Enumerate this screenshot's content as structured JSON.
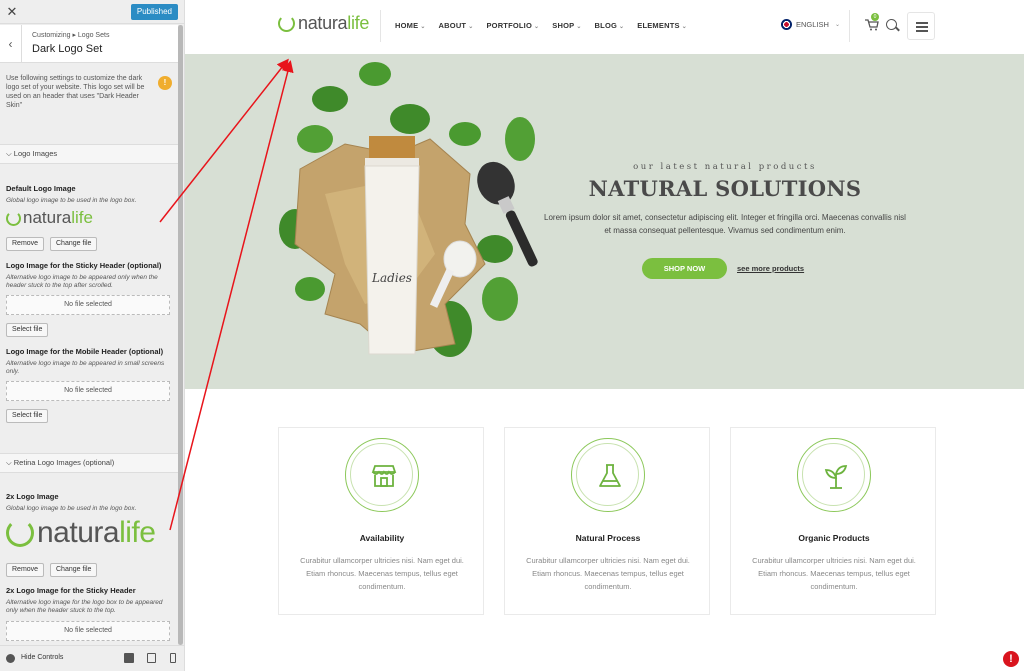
{
  "customizer": {
    "close": "✕",
    "publish_label": "Published",
    "back": "‹",
    "breadcrumb": "Customizing ▸ Logo Sets",
    "panel_title": "Dark Logo Set",
    "description": "Use following settings to customize the dark logo set of your website. This logo set will be used on an header that uses \"Dark Header Skin\"",
    "info_badge": "!",
    "section_logo_images": "⌵ Logo Images",
    "default_logo": {
      "label": "Default Logo Image",
      "help": "Global logo image to be used in the logo box.",
      "remove": "Remove",
      "change": "Change file"
    },
    "sticky_logo": {
      "label": "Logo Image for the Sticky Header (optional)",
      "help": "Alternative logo image to be appeared only when the header stuck to the top after scrolled.",
      "no_file": "No file selected",
      "select": "Select file"
    },
    "mobile_logo": {
      "label": "Logo Image for the Mobile Header (optional)",
      "help": "Alternative logo image to be appeared in small screens only.",
      "no_file": "No file selected",
      "select": "Select file"
    },
    "section_retina": "⌵ Retina Logo Images (optional)",
    "retina_logo": {
      "label": "2x Logo Image",
      "help": "Global logo image to be used in the logo box.",
      "remove": "Remove",
      "change": "Change file"
    },
    "retina_sticky": {
      "label": "2x Logo Image for the Sticky Header",
      "help": "Alternative logo image for the logo box to be appeared only when the header stuck to the top.",
      "no_file": "No file selected"
    },
    "hide_controls": "Hide Controls"
  },
  "logo": {
    "part1": "natura",
    "part2": "life"
  },
  "site": {
    "nav": [
      {
        "label": "HOME"
      },
      {
        "label": "ABOUT"
      },
      {
        "label": "PORTFOLIO"
      },
      {
        "label": "SHOP"
      },
      {
        "label": "BLOG"
      },
      {
        "label": "ELEMENTS"
      }
    ],
    "caret": "⌄",
    "language": "ENGLISH",
    "cart_count": "0",
    "hero": {
      "kicker": "our latest natural products",
      "title": "NATURAL SOLUTIONS",
      "text": "Lorem ipsum dolor sit amet, consectetur adipiscing elit. Integer et fringilla orci. Maecenas convallis nisl et massa consequat pellentesque. Vivamus sed condimentum enim.",
      "cta": "SHOP NOW",
      "link": "see more products",
      "tube_label": "Ladies"
    },
    "features": [
      {
        "icon": "store-icon",
        "title": "Availability",
        "text": "Curabitur ullamcorper ultricies nisi. Nam eget dui. Etiam rhoncus. Maecenas tempus, tellus eget condimentum."
      },
      {
        "icon": "flask-icon",
        "title": "Natural Process",
        "text": "Curabitur ullamcorper ultricies nisi. Nam eget dui. Etiam rhoncus. Maecenas tempus, tellus eget condimentum."
      },
      {
        "icon": "sprout-icon",
        "title": "Organic Products",
        "text": "Curabitur ullamcorper ultricies nisi. Nam eget dui. Etiam rhoncus. Maecenas tempus, tellus eget condimentum."
      }
    ],
    "alert": "!"
  },
  "colors": {
    "accent_green": "#7bbf3f",
    "publish_blue": "#2b8cc4",
    "hero_bg": "#d7dfd4",
    "annotation_red": "#e8141b"
  }
}
